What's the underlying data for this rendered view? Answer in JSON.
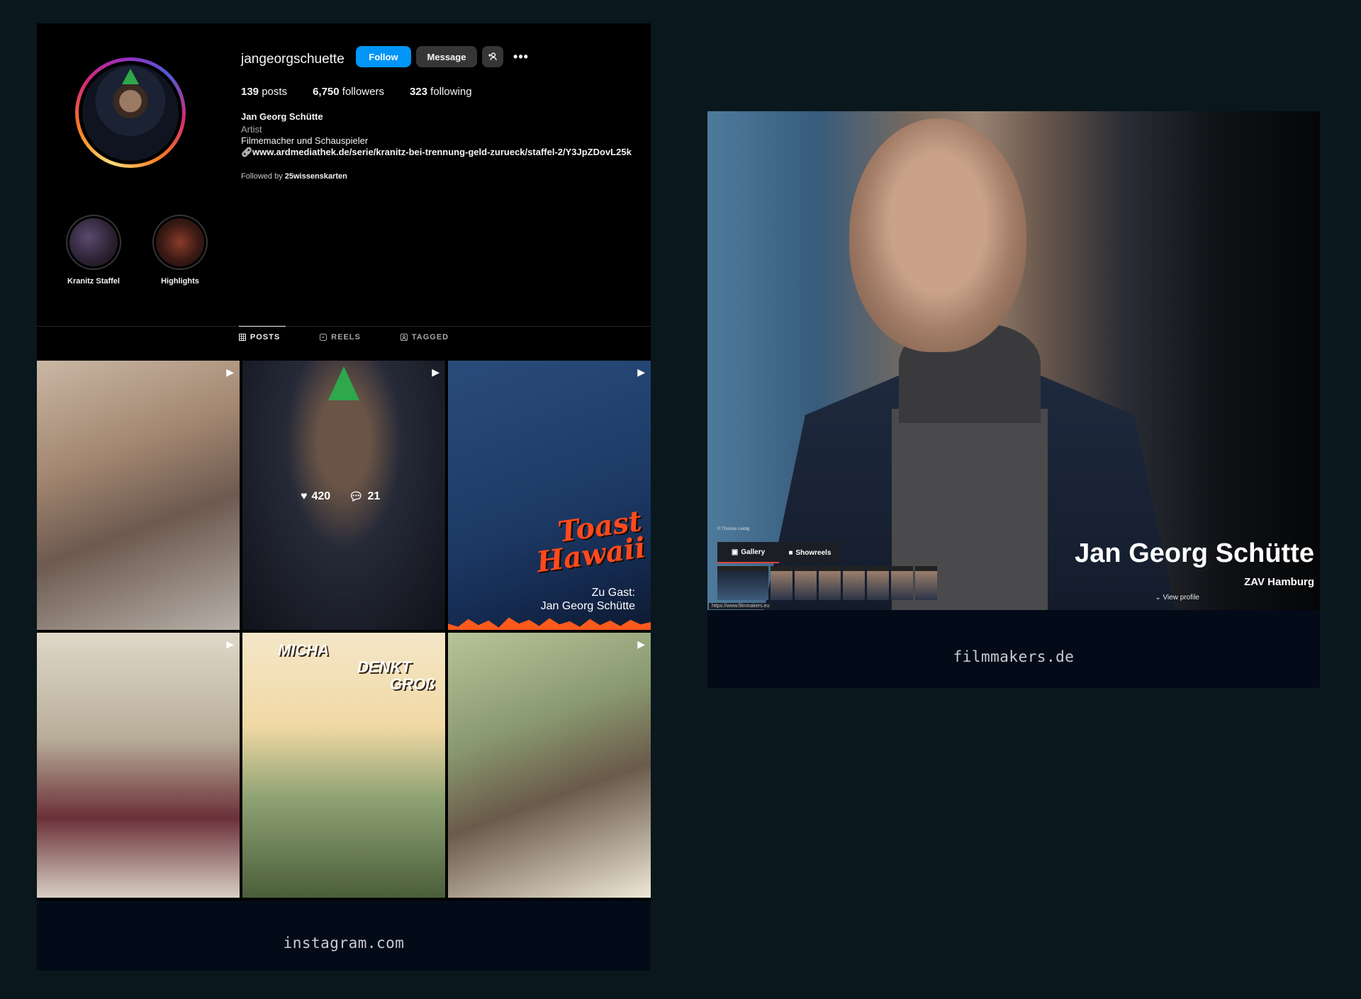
{
  "instagram": {
    "username": "jangeorgschuette",
    "follow_label": "Follow",
    "message_label": "Message",
    "add_user_icon": "add-user-icon",
    "more_icon": "more-icon",
    "stats": {
      "posts": "139",
      "posts_label": "posts",
      "followers": "6,750",
      "followers_label": "followers",
      "following": "323",
      "following_label": "following"
    },
    "bio": {
      "name": "Jan Georg Schütte",
      "category": "Artist",
      "text": "Filmemacher und Schauspieler",
      "link": "www.ardmediathek.de/serie/kranitz-bei-trennung-geld-zurueck/staffel-2/Y3JpZDovL25k",
      "followed_prefix": "Followed by",
      "followed_by": "25wissenskarten"
    },
    "highlights": [
      {
        "label": "Kranitz Staffel"
      },
      {
        "label": "Highlights"
      }
    ],
    "tabs": [
      {
        "label": "POSTS",
        "icon": "grid-icon",
        "active": true
      },
      {
        "label": "REELS",
        "icon": "reels-icon",
        "active": false
      },
      {
        "label": "TAGGED",
        "icon": "tagged-icon",
        "active": false
      }
    ],
    "hover_post": {
      "likes": "420",
      "comments": "21"
    },
    "post3": {
      "title_line1": "Toast",
      "title_line2": "Hawaii",
      "guest_line1": "Zu Gast:",
      "guest_line2": "Jan Georg Schütte"
    },
    "post5": {
      "line1": "MICHA",
      "line2": "DENKT",
      "line3": "GROß"
    },
    "footer": "instagram.com"
  },
  "filmmakers": {
    "name": "Jan Georg Schütte",
    "agency": "ZAV Hamburg",
    "view_profile": "View profile",
    "photo_credit": "© Thomas Leidig",
    "tab_gallery": "Gallery",
    "tab_showreels": "Showreels",
    "url": "https://www.filmmakers.eu",
    "footer": "filmmakers.de"
  }
}
